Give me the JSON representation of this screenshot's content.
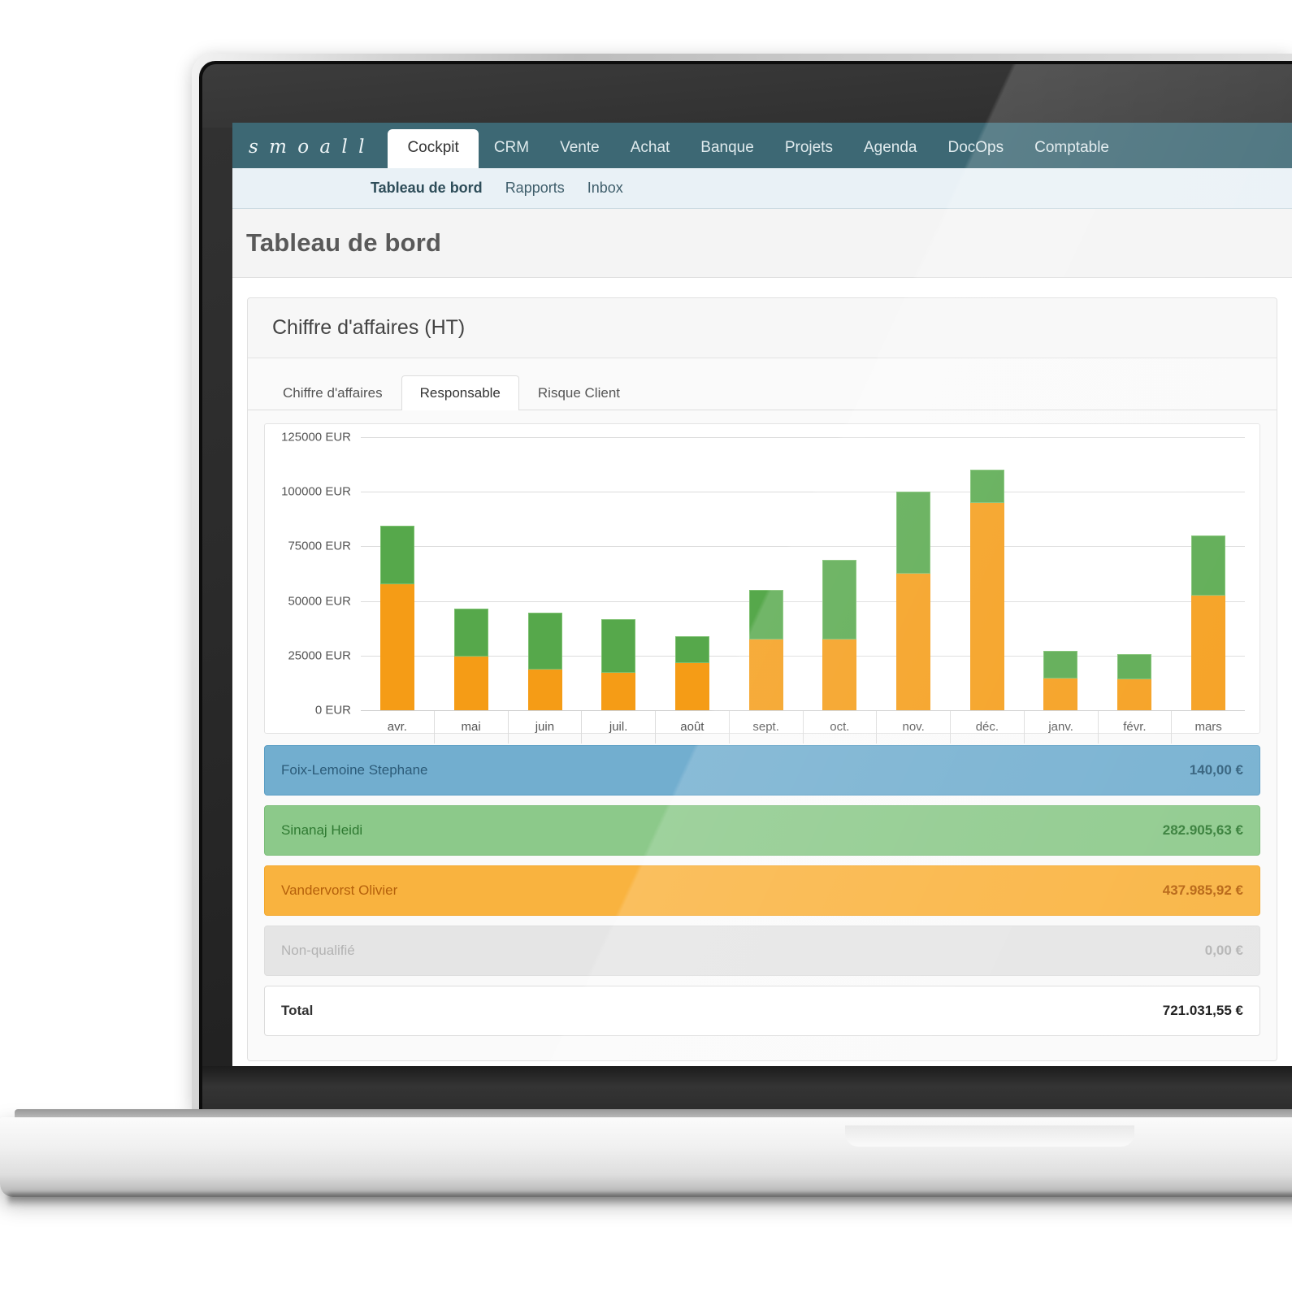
{
  "app": {
    "logo": "s m o a l l",
    "nav": [
      {
        "label": "Cockpit",
        "active": true
      },
      {
        "label": "CRM",
        "active": false
      },
      {
        "label": "Vente",
        "active": false
      },
      {
        "label": "Achat",
        "active": false
      },
      {
        "label": "Banque",
        "active": false
      },
      {
        "label": "Projets",
        "active": false
      },
      {
        "label": "Agenda",
        "active": false
      },
      {
        "label": "DocOps",
        "active": false
      },
      {
        "label": "Comptable",
        "active": false
      }
    ],
    "subnav": [
      {
        "label": "Tableau de bord",
        "active": true
      },
      {
        "label": "Rapports",
        "active": false
      },
      {
        "label": "Inbox",
        "active": false
      }
    ],
    "page_title": "Tableau de bord"
  },
  "card": {
    "title": "Chiffre d'affaires (HT)",
    "tabs": [
      {
        "label": "Chiffre d'affaires",
        "active": false
      },
      {
        "label": "Responsable",
        "active": true
      },
      {
        "label": "Risque Client",
        "active": false
      }
    ]
  },
  "legend": {
    "rows": [
      {
        "name": "Foix-Lemoine Stephane",
        "value": "140,00 €",
        "color": "#72aecf",
        "style": "blue"
      },
      {
        "name": "Sinanaj Heidi",
        "value": "282.905,63 €",
        "color": "#8cc98a",
        "style": "green"
      },
      {
        "name": "Vandervorst Olivier",
        "value": "437.985,92 €",
        "color": "#f9b33f",
        "style": "orange"
      },
      {
        "name": "Non-qualifié",
        "value": "0,00 €",
        "color": "#e5e5e5",
        "style": "grey"
      }
    ],
    "total": {
      "name": "Total",
      "value": "721.031,55 €"
    }
  },
  "chart_data": {
    "type": "bar",
    "stacked": true,
    "title": "Chiffre d'affaires (HT)",
    "xlabel": "",
    "ylabel": "",
    "ylim": [
      0,
      125000
    ],
    "grid": true,
    "legend_position": "below",
    "currency": "EUR",
    "ytick_labels": [
      "125000 EUR",
      "100000 EUR",
      "75000 EUR",
      "50000 EUR",
      "25000 EUR",
      "0 EUR"
    ],
    "ytick_values": [
      125000,
      100000,
      75000,
      50000,
      25000,
      0
    ],
    "categories": [
      "avr.",
      "mai",
      "juin",
      "juil.",
      "août",
      "sept.",
      "oct.",
      "nov.",
      "déc.",
      "janv.",
      "févr.",
      "mars"
    ],
    "series": [
      {
        "name": "Vandervorst Olivier",
        "color": "#f59c16",
        "values": [
          57500,
          24500,
          18500,
          17000,
          21500,
          32500,
          32500,
          62500,
          95000,
          14500,
          14000,
          52500
        ]
      },
      {
        "name": "Sinanaj Heidi",
        "color": "#56a84b",
        "values": [
          27000,
          22000,
          26000,
          24500,
          12500,
          22500,
          36500,
          37500,
          15000,
          12500,
          11500,
          27500
        ]
      }
    ],
    "totals": [
      84500,
      46500,
      44500,
      41500,
      34000,
      55000,
      69000,
      100000,
      110000,
      27000,
      25500,
      80000
    ]
  }
}
